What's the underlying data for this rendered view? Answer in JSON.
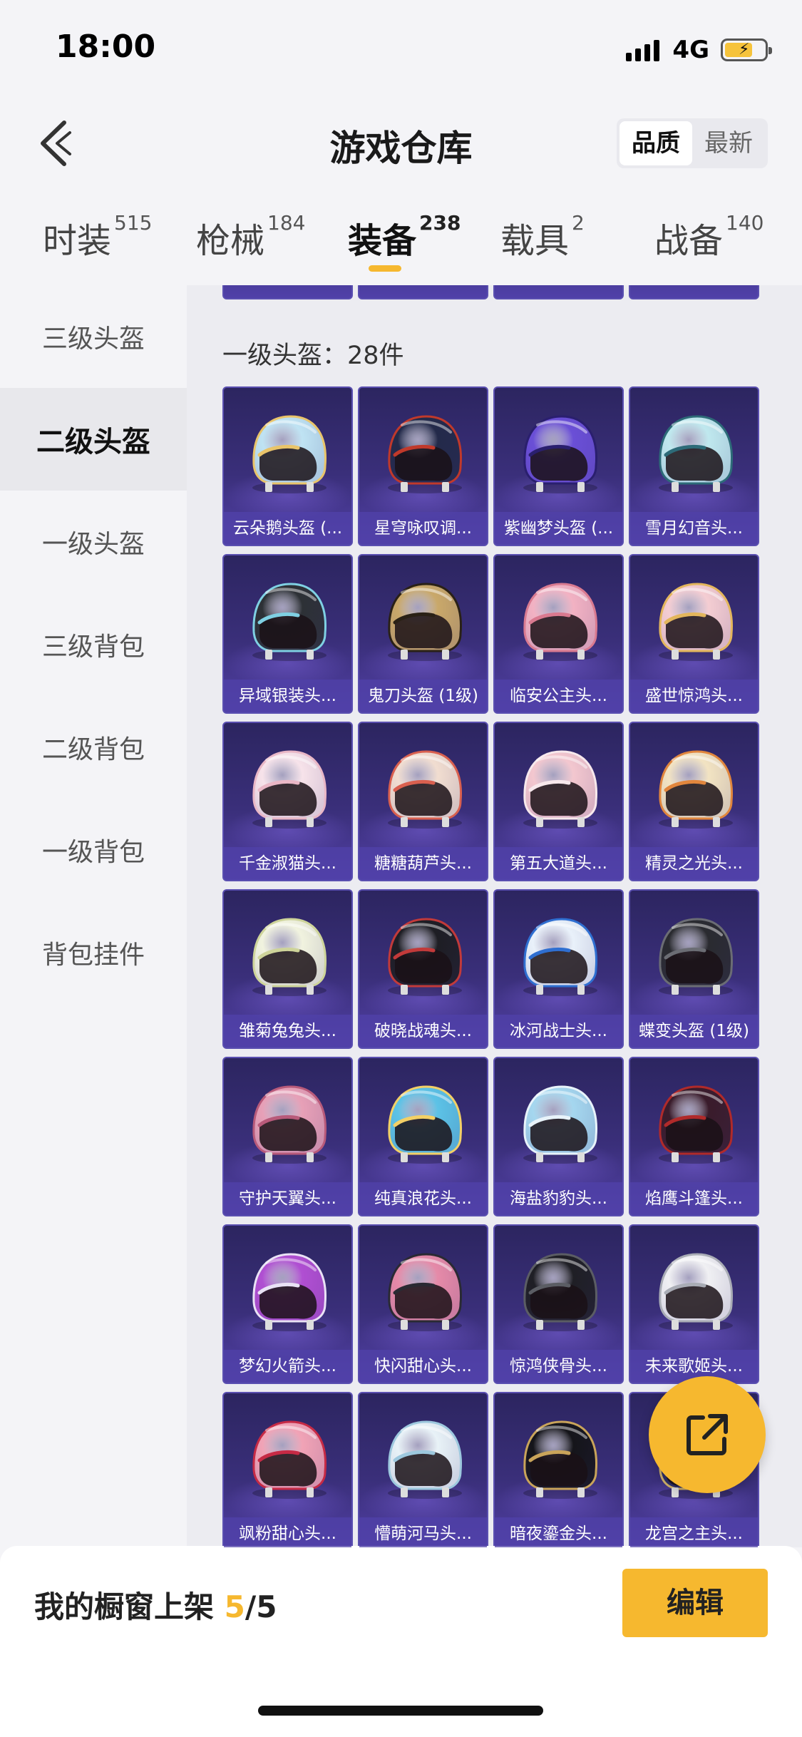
{
  "status": {
    "time": "18:00",
    "network": "4G"
  },
  "header": {
    "title": "游戏仓库",
    "sort_options": [
      "品质",
      "最新"
    ],
    "sort_active": "品质"
  },
  "tabs": [
    {
      "label": "时装",
      "count": "515"
    },
    {
      "label": "枪械",
      "count": "184"
    },
    {
      "label": "装备",
      "count": "238"
    },
    {
      "label": "载具",
      "count": "2"
    },
    {
      "label": "战备",
      "count": "140"
    }
  ],
  "active_tab": "装备",
  "sidebar": {
    "items": [
      "三级头盔",
      "二级头盔",
      "一级头盔",
      "三级背包",
      "二级背包",
      "一级背包",
      "背包挂件"
    ],
    "active": "二级头盔"
  },
  "partial_row": [
    "惊鸿侠骨头...",
    "飒粉甜心头...",
    "第五大道头...",
    "暗夜鎏金头..."
  ],
  "section": {
    "title": "一级头盔：28件"
  },
  "items": [
    {
      "name": "云朵鹅头盔 (...",
      "colors": [
        "#bfe3f3",
        "#e9c46a"
      ]
    },
    {
      "name": "星穹咏叹调...",
      "colors": [
        "#232a4a",
        "#c0392b"
      ]
    },
    {
      "name": "紫幽梦头盔 (...",
      "colors": [
        "#6a4fd6",
        "#2a1f6e"
      ]
    },
    {
      "name": "雪月幻音头...",
      "colors": [
        "#bfe8ee",
        "#2d6b78"
      ]
    },
    {
      "name": "异域银装头...",
      "colors": [
        "#2d3136",
        "#7fd0e3"
      ]
    },
    {
      "name": "鬼刀头盔 (1级)",
      "colors": [
        "#c9a86a",
        "#2a2116"
      ]
    },
    {
      "name": "临安公主头...",
      "colors": [
        "#f2b2c3",
        "#d97a90"
      ]
    },
    {
      "name": "盛世惊鸿头...",
      "colors": [
        "#f4cdd2",
        "#e3b65c"
      ]
    },
    {
      "name": "千金淑猫头...",
      "colors": [
        "#f7e3ea",
        "#e9b7c6"
      ]
    },
    {
      "name": "糖糖葫芦头...",
      "colors": [
        "#f1ddd0",
        "#d9604f"
      ]
    },
    {
      "name": "第五大道头...",
      "colors": [
        "#f3c7cf",
        "#f7e8ec"
      ]
    },
    {
      "name": "精灵之光头...",
      "colors": [
        "#f2e3c2",
        "#e1863d"
      ]
    },
    {
      "name": "雏菊兔兔头...",
      "colors": [
        "#f1f3df",
        "#ced49a"
      ]
    },
    {
      "name": "破晓战魂头...",
      "colors": [
        "#1e1e24",
        "#c23a3a"
      ]
    },
    {
      "name": "冰河战士头...",
      "colors": [
        "#e9f1fa",
        "#2f6fd1"
      ]
    },
    {
      "name": "蝶变头盔 (1级)",
      "colors": [
        "#2a2b30",
        "#6b6d74"
      ]
    },
    {
      "name": "守护天翼头...",
      "colors": [
        "#e7a0b7",
        "#b85a7a"
      ]
    },
    {
      "name": "纯真浪花头...",
      "colors": [
        "#5cc2e6",
        "#f3d066"
      ]
    },
    {
      "name": "海盐豹豹头...",
      "colors": [
        "#a5d7ef",
        "#e8f3fa"
      ]
    },
    {
      "name": "焰鹰斗篷头...",
      "colors": [
        "#3a1c2b",
        "#b02a2a"
      ]
    },
    {
      "name": "梦幻火箭头...",
      "colors": [
        "#b04fd2",
        "#e9e2f5"
      ]
    },
    {
      "name": "快闪甜心头...",
      "colors": [
        "#e58aa8",
        "#2a2a33"
      ]
    },
    {
      "name": "惊鸿侠骨头...",
      "colors": [
        "#1f1f25",
        "#5b5d64"
      ]
    },
    {
      "name": "未来歌姬头...",
      "colors": [
        "#f0f0f3",
        "#a9acb5"
      ]
    },
    {
      "name": "飒粉甜心头...",
      "colors": [
        "#f1a3b6",
        "#c62a45"
      ]
    },
    {
      "name": "懵萌河马头...",
      "colors": [
        "#e8f2f7",
        "#9dc8de"
      ]
    },
    {
      "name": "暗夜鎏金头...",
      "colors": [
        "#15151a",
        "#c9a45a"
      ]
    },
    {
      "name": "龙宫之主头...",
      "colors": [
        "#2b2f6a",
        "#d1b36a"
      ]
    }
  ],
  "bottom": {
    "shelf_label": "我的橱窗上架",
    "shelf_current": "5",
    "shelf_total": "/5",
    "edit_label": "编辑"
  },
  "accent_color": "#f6b82f",
  "icons": {
    "back": "chevron-left-icon",
    "fab": "share-external-icon"
  }
}
